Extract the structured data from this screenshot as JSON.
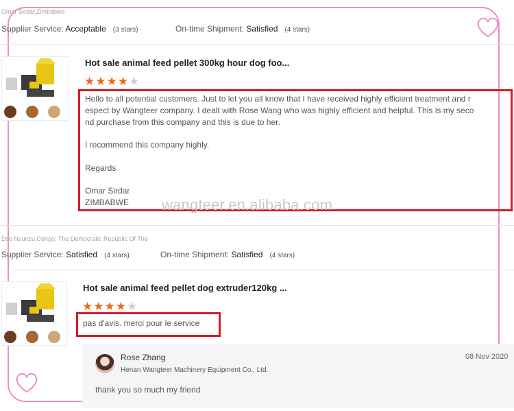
{
  "watermark": "wangteer.en.alibaba.com",
  "reviews": [
    {
      "buyer": "Omar Sirdar,Zimbabwe",
      "supplier_service_label": "Supplier Service:",
      "supplier_service_value": "Acceptable",
      "supplier_service_stars": "(3 stars)",
      "shipment_label": "On-time Shipment:",
      "shipment_value": "Satisfied",
      "shipment_stars": "(4 stars)",
      "product_title": "Hot sale animal feed pellet 300kg hour dog foo...",
      "rating": 4,
      "rating_max": 5,
      "text_lines": [
        "Hello to all potential customers. Just to let you all know that I have received highly efficient treatment and r",
        "espect by Wangteer company. I dealt with Rose Wang who was highly efficient and helpful. This is my seco",
        "nd purchase from this company and this is due to her.",
        "",
        "I recommend this company highly.",
        "",
        "Regards",
        "",
        "Omar Sirdar",
        "ZIMBABWE"
      ]
    },
    {
      "buyer": "Dso Nsunzu,Congo, The Democratic Republic Of The",
      "supplier_service_label": "Supplier Service:",
      "supplier_service_value": "Satisfied",
      "supplier_service_stars": "(4 stars)",
      "shipment_label": "On-time Shipment:",
      "shipment_value": "Satisfied",
      "shipment_stars": "(4 stars)",
      "product_title": "Hot sale animal feed pellet dog extruder120kg ...",
      "rating": 4,
      "rating_max": 5,
      "text_lines": [
        "pas d'avis. merci pour le service"
      ],
      "reply": {
        "name": "Rose Zhang",
        "company": "Henan Wangteer Machinery Equipment Co., Ltd.",
        "date": "08 Nov 2020",
        "text": "thank you so much my friend"
      }
    }
  ],
  "colors": {
    "star_on": "#f06a1d",
    "star_off": "#cfcfcf",
    "highlight": "#d21c28",
    "frame": "#f08cc2"
  },
  "icons": [
    "heart-ornament-icon",
    "star-icon",
    "pellet-machine-image",
    "feed-pellet-icon",
    "avatar"
  ]
}
